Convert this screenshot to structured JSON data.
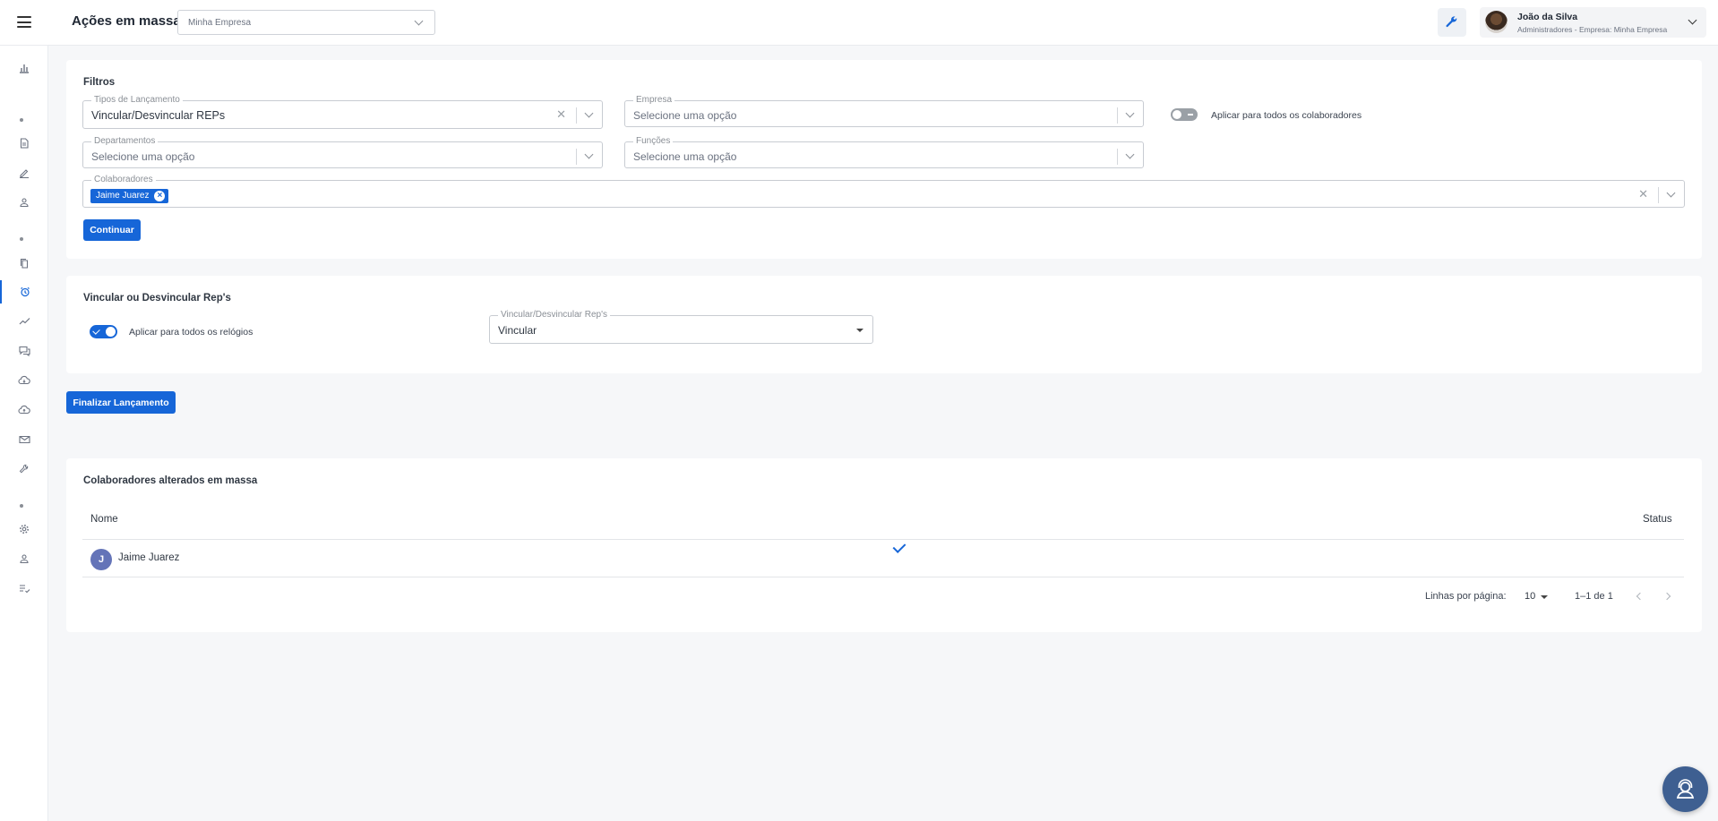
{
  "header": {
    "title": "Ações em massa",
    "company_select": {
      "value": "Minha Empresa"
    },
    "user": {
      "name": "João da Silva",
      "role": "Administradores - Empresa: Minha Empresa"
    }
  },
  "sidebar": {
    "items": [
      {
        "icon": "bar-chart-icon"
      },
      {
        "icon": "document-icon"
      },
      {
        "icon": "pen-icon"
      },
      {
        "icon": "user-icon"
      },
      {
        "icon": "copy-icon"
      },
      {
        "icon": "alarm-clock-icon",
        "active": true
      },
      {
        "icon": "trend-line-icon"
      },
      {
        "icon": "chat-icon"
      },
      {
        "icon": "cloud-download-icon"
      },
      {
        "icon": "cloud-upload-icon"
      },
      {
        "icon": "mail-icon"
      },
      {
        "icon": "wrench-icon"
      },
      {
        "icon": "gear-icon"
      },
      {
        "icon": "user-icon"
      },
      {
        "icon": "checklist-icon"
      }
    ]
  },
  "filters": {
    "title": "Filtros",
    "tipos": {
      "label": "Tipos de Lançamento",
      "value": "Vincular/Desvincular REPs"
    },
    "empresa": {
      "label": "Empresa",
      "placeholder": "Selecione uma opção"
    },
    "aplicar_todos_colaboradores": {
      "label": "Aplicar para todos os colaboradores",
      "checked": false
    },
    "departamentos": {
      "label": "Departamentos",
      "placeholder": "Selecione uma opção"
    },
    "funcoes": {
      "label": "Funções",
      "placeholder": "Selecione uma opção"
    },
    "colaboradores": {
      "label": "Colaboradores",
      "chips": [
        "Jaime Juarez"
      ]
    },
    "continue_label": "Continuar"
  },
  "vincular": {
    "title": "Vincular ou Desvincular Rep's",
    "aplicar_todos_relogios": {
      "label": "Aplicar para todos os relógios",
      "checked": true
    },
    "select": {
      "label": "Vincular/Desvincular Rep's",
      "value": "Vincular"
    }
  },
  "finalizar_label": "Finalizar Lançamento",
  "results": {
    "title": "Colaboradores alterados em massa",
    "columns": [
      "Nome",
      "Status"
    ],
    "rows": [
      {
        "initial": "J",
        "name": "Jaime Juarez",
        "status": "success"
      }
    ],
    "pagination": {
      "rows_label": "Linhas por página:",
      "rows_per_page": "10",
      "range": "1–1 de 1"
    }
  },
  "colors": {
    "primary": "#1666d8",
    "background": "#f6f7f9",
    "avatar": "#6474b8",
    "fab": "#3e5f91"
  }
}
